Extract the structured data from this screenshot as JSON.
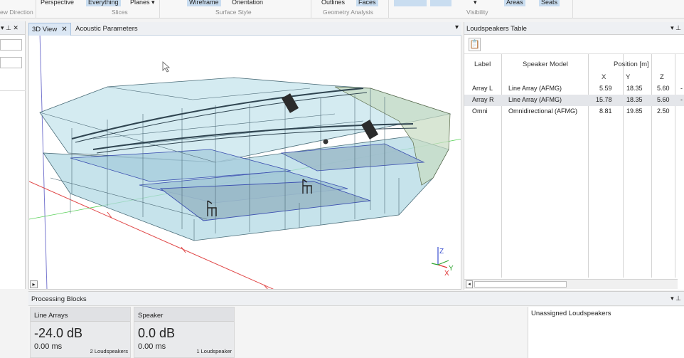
{
  "ribbon": {
    "buttons": {
      "perspective": "Perspective",
      "everything": "Everything",
      "planes": "Planes ▾",
      "wireframe": "Wireframe",
      "orientation": "Orientation",
      "outlines": "Outlines",
      "faces": "Faces",
      "visibility_dropdown": "▾",
      "areas": "Areas",
      "seats": "Seats"
    },
    "groups": {
      "view_direction": "ew Direction",
      "slices": "Slices",
      "surface_style": "Surface Style",
      "geometry_analysis": "Geometry Analysis",
      "visibility": "Visibility"
    }
  },
  "left_panel": {
    "controls": "▾ ⊥ ✕"
  },
  "tabs": [
    {
      "label": "3D View",
      "close": "✕"
    },
    {
      "label": "Acoustic Parameters"
    }
  ],
  "tab_menu": "▾",
  "viewport": {
    "axis_labels": {
      "z": "Z",
      "y": "Y",
      "x": "X"
    },
    "select_tool": "▸"
  },
  "loudspeakers_table": {
    "title": "Loudspeakers Table",
    "pin_controls": "▾ ⊥",
    "copy_icon": "📋",
    "headers": {
      "label": "Label",
      "model": "Speaker Model",
      "position": "Position [m]",
      "x": "X",
      "y": "Y",
      "z": "Z"
    },
    "rows": [
      {
        "label": "Array L",
        "model": "Line Array (AFMG)",
        "x": "5.59",
        "y": "18.35",
        "z": "5.60",
        "extra": "-"
      },
      {
        "label": "Array R",
        "model": "Line Array (AFMG)",
        "x": "15.78",
        "y": "18.35",
        "z": "5.60",
        "extra": "-"
      },
      {
        "label": "Omni",
        "model": "Omnidirectional (AFMG)",
        "x": "8.81",
        "y": "19.85",
        "z": "2.50",
        "extra": ""
      }
    ],
    "scroll_left": "◂"
  },
  "processing_blocks": {
    "title": "Processing Blocks",
    "pin_controls": "▾ ⊥",
    "blocks": [
      {
        "name": "Line Arrays",
        "gain": "-24.0 dB",
        "delay": "0.00 ms",
        "count": "2 Loudspeakers"
      },
      {
        "name": "Speaker",
        "gain": "0.0 dB",
        "delay": "0.00 ms",
        "count": "1 Loudspeaker"
      }
    ],
    "unassigned": "Unassigned Loudspeakers"
  }
}
